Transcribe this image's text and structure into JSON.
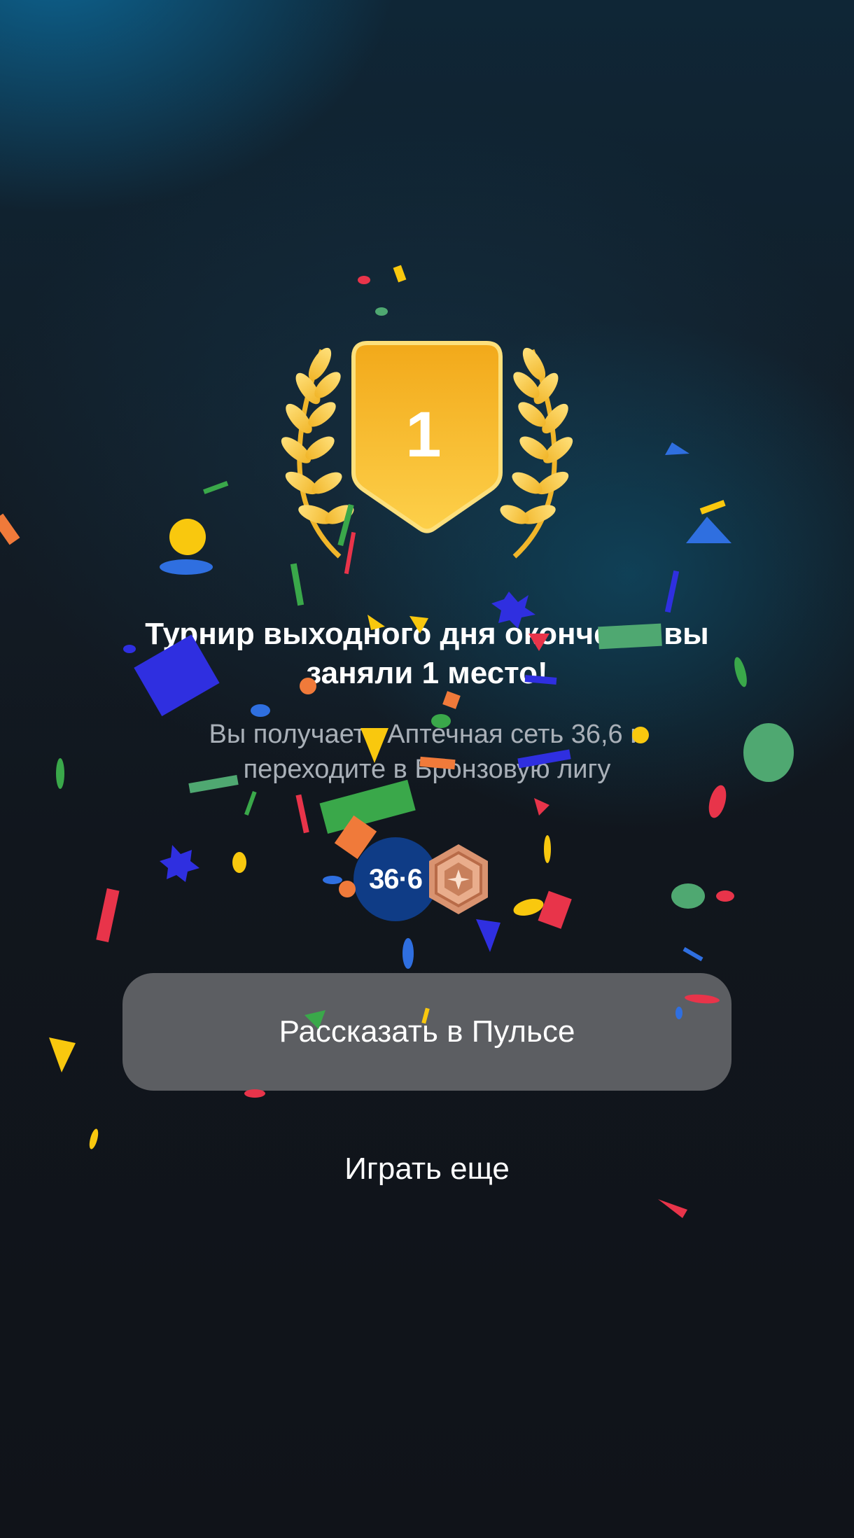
{
  "result": {
    "place": "1",
    "title": "Турнир выходного дня окончен – вы заняли 1 место!",
    "subtitle": "Вы получаете Аптечная сеть 36,6 и переходите в Бронзовую лигу"
  },
  "badges": {
    "brand_logo_text": "36·6",
    "brand_icon": "pharmacy-36-6-logo",
    "league_icon": "bronze-league-badge"
  },
  "actions": {
    "share_label": "Рассказать в Пульсе",
    "play_again_label": "Играть еще"
  },
  "colors": {
    "gold": "#f4b521",
    "button_bg": "#5c5e62",
    "brand_blue": "#0f3c86",
    "bronze": "#d99370"
  }
}
